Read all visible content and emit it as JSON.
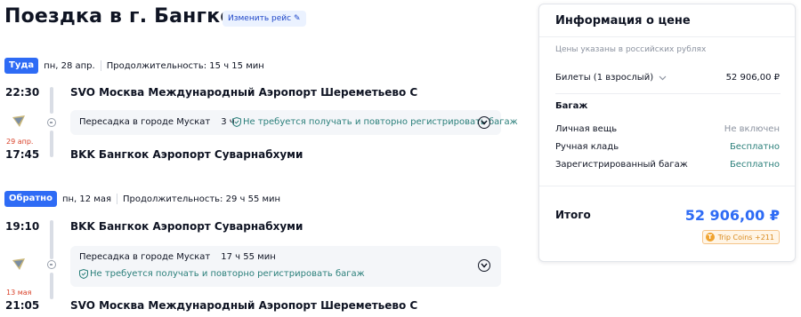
{
  "page_title": "Поездка в г. Бангкок",
  "change_button": "Изменить рейс",
  "outbound": {
    "badge": "Туда",
    "date": "пн, 28 апр.",
    "duration": "Продолжительность: 15 ч 15 мин",
    "depart_time": "22:30",
    "depart_airport": "SVO Москва Международный Аэропорт Шереметьево С",
    "layover_city": "Пересадка в городе Мускат",
    "layover_duration": "3 ч",
    "layover_note": "Не требуется получать и повторно регистрировать багаж",
    "arrive_date": "29 апр.",
    "arrive_time": "17:45",
    "arrive_airport": "BKK Бангкок Аэропорт Суварнабхуми"
  },
  "return": {
    "badge": "Обратно",
    "date": "пн, 12 мая",
    "duration": "Продолжительность: 29 ч 55 мин",
    "depart_time": "19:10",
    "depart_airport": "BKK Бангкок Аэропорт Суварнабхуми",
    "layover_city": "Пересадка в городе Мускат",
    "layover_duration": "17 ч 55 мин",
    "layover_note": "Не требуется получать и повторно регистрировать багаж",
    "arrive_date": "13 мая",
    "arrive_time": "21:05",
    "arrive_airport": "SVO Москва Международный Аэропорт Шереметьево С"
  },
  "price_panel": {
    "title": "Информация о цене",
    "currency_note": "Цены указаны в российских рублях",
    "tickets_label": "Билеты (1 взрослый)",
    "tickets_price": "52 906,00 ₽",
    "baggage_title": "Багаж",
    "baggage": [
      {
        "label": "Личная вещь",
        "value": "Не включен"
      },
      {
        "label": "Ручная кладь",
        "value": "Бесплатно"
      },
      {
        "label": "Зарегистрированный багаж",
        "value": "Бесплатно"
      }
    ],
    "total_label": "Итого",
    "total_price": "52 906,00 ₽",
    "coins_label": "Trip Coins +211"
  },
  "colors": {
    "accent": "#2e6bf5",
    "free": "#2a7f7a",
    "arrival_date": "#d9432b"
  }
}
